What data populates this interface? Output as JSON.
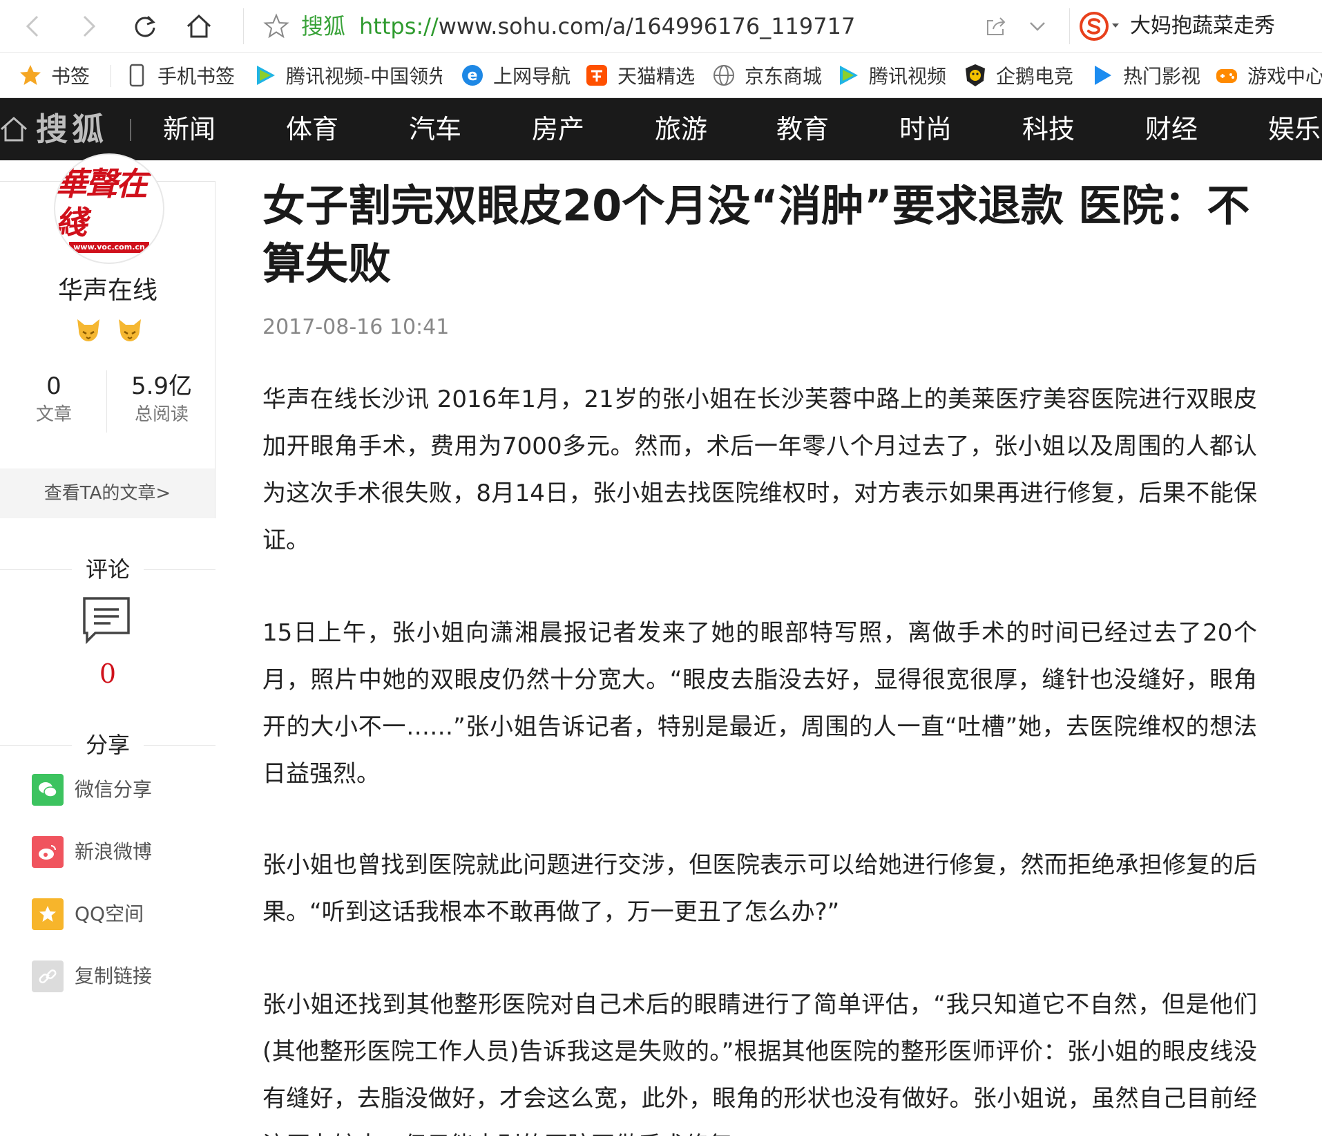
{
  "browser": {
    "site_name": "搜狐",
    "url_protocol": "https://",
    "url_rest": "www.sohu.com/a/164996176_119717",
    "hot_word": "大妈抱蔬菜走秀"
  },
  "bookmarks": [
    {
      "label": "书签",
      "icon": "star-icon"
    },
    {
      "label": "手机书签",
      "icon": "phone-icon"
    },
    {
      "label": "腾讯视频-中国领先",
      "icon": "play-icon"
    },
    {
      "label": "上网导航",
      "icon": "ie-icon"
    },
    {
      "label": "天猫精选",
      "icon": "tmall-icon"
    },
    {
      "label": "京东商城",
      "icon": "globe-icon"
    },
    {
      "label": "腾讯视频",
      "icon": "play-icon"
    },
    {
      "label": "企鹅电竞",
      "icon": "penguin-icon"
    },
    {
      "label": "热门影视",
      "icon": "play-blue-icon"
    },
    {
      "label": "游戏中心",
      "icon": "gamepad-icon"
    }
  ],
  "nav": {
    "logo": "搜狐",
    "items": [
      "新闻",
      "体育",
      "汽车",
      "房产",
      "旅游",
      "教育",
      "时尚",
      "科技",
      "财经",
      "娱乐"
    ]
  },
  "author": {
    "avatar_text": "華聲在綫",
    "avatar_url": "www.voc.com.cn",
    "name": "华声在线",
    "articles_count": "0",
    "articles_label": "文章",
    "reads_count": "5.9亿",
    "reads_label": "总阅读",
    "view_articles": "查看TA的文章>"
  },
  "comments": {
    "heading": "评论",
    "count": "0"
  },
  "share": {
    "heading": "分享",
    "items": [
      {
        "label": "微信分享",
        "color": "#3cc35f"
      },
      {
        "label": "新浪微博",
        "color": "#f0545e"
      },
      {
        "label": "QQ空间",
        "color": "#f7b52b"
      },
      {
        "label": "复制链接",
        "color": "#dcdcdc"
      }
    ]
  },
  "article": {
    "title": "女子割完双眼皮20个月没“消肿”要求退款 医院：不算失败",
    "date": "2017-08-16 10:41",
    "paragraphs": [
      "华声在线长沙讯 2016年1月，21岁的张小姐在长沙芙蓉中路上的美莱医疗美容医院进行双眼皮加开眼角手术，费用为7000多元。然而，术后一年零八个月过去了，张小姐以及周围的人都认为这次手术很失败，8月14日，张小姐去找医院维权时，对方表示如果再进行修复，后果不能保证。",
      "15日上午，张小姐向潇湘晨报记者发来了她的眼部特写照，离做手术的时间已经过去了20个月，照片中她的双眼皮仍然十分宽大。“眼皮去脂没去好，显得很宽很厚，缝针也没缝好，眼角开的大小不一……”张小姐告诉记者，特别是最近，周围的人一直“吐槽”她，去医院维权的想法日益强烈。",
      "张小姐也曾找到医院就此问题进行交涉，但医院表示可以给她进行修复，然而拒绝承担修复的后果。“听到这话我根本不敢再做了，万一更丑了怎么办?”",
      "张小姐还找到其他整形医院对自己术后的眼睛进行了简单评估，“我只知道它不自然，但是他们(其他整形医院工作人员)告诉我这是失败的。”根据其他医院的整形医师评价：张小姐的眼皮线没有缝好，去脂没做好，才会这么宽，此外，眼角的形状也没有做好。张小姐说，虽然自己目前经济压力较大，但只能去别的医院再做手术修复。"
    ]
  }
}
